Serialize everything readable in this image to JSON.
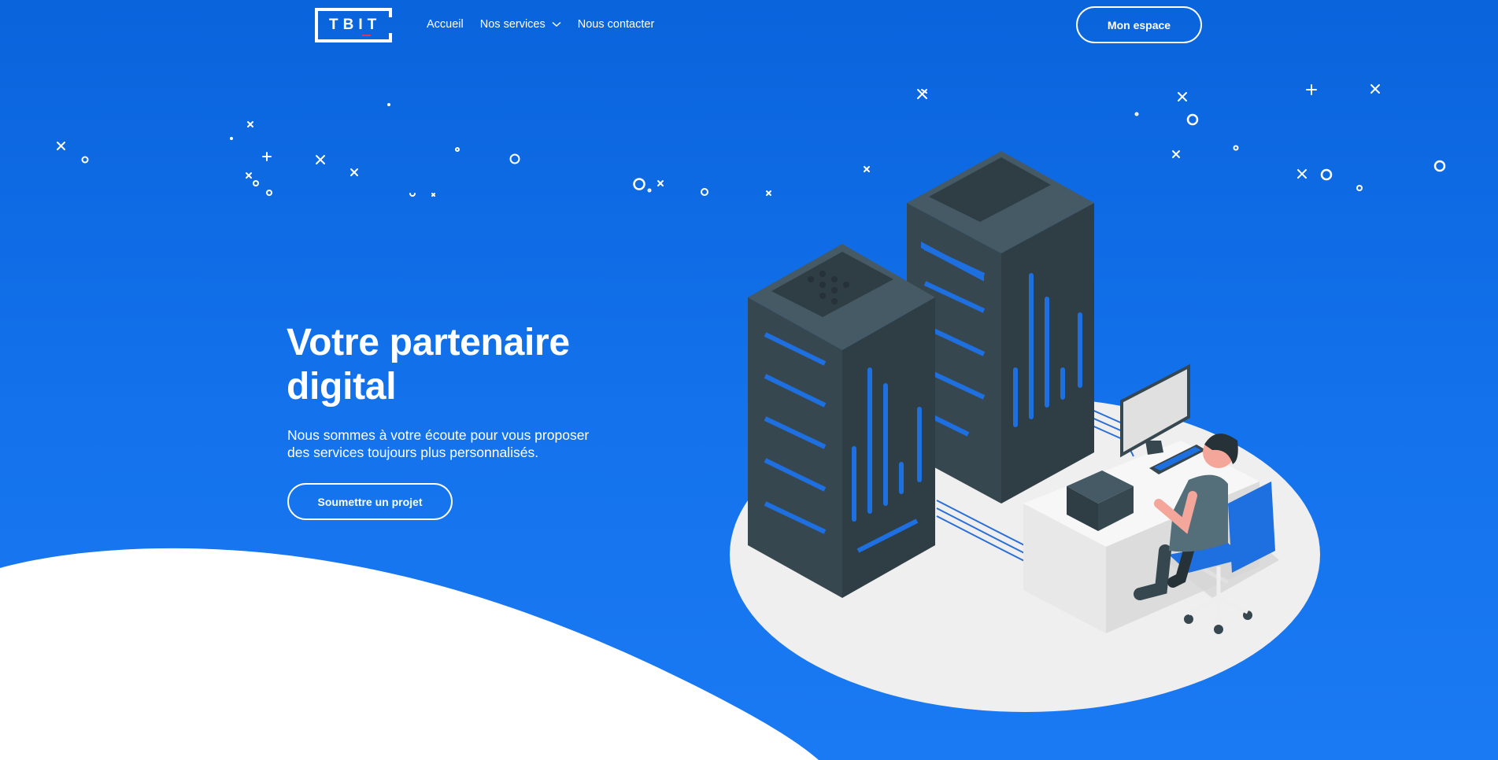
{
  "brand": {
    "logo_text": "TBIT"
  },
  "nav": {
    "links": [
      {
        "label": "Accueil"
      },
      {
        "label": "Nos services",
        "has_dropdown": true
      },
      {
        "label": "Nous contacter"
      }
    ],
    "account_button": "Mon espace"
  },
  "hero": {
    "title": "Votre partenaire digital",
    "subtitle": "Nous sommes à votre écoute pour vous proposer des services toujours plus personnalisés.",
    "cta_label": "Soumettre un projet"
  },
  "illustration": {
    "icon": "server-room-illustration"
  },
  "colors": {
    "primary_blue": "#0a64dc",
    "hero_blue_light": "#1a7af4",
    "server_dark": "#37474f",
    "server_accent": "#1e6fe0",
    "wave_white": "#ffffff"
  }
}
